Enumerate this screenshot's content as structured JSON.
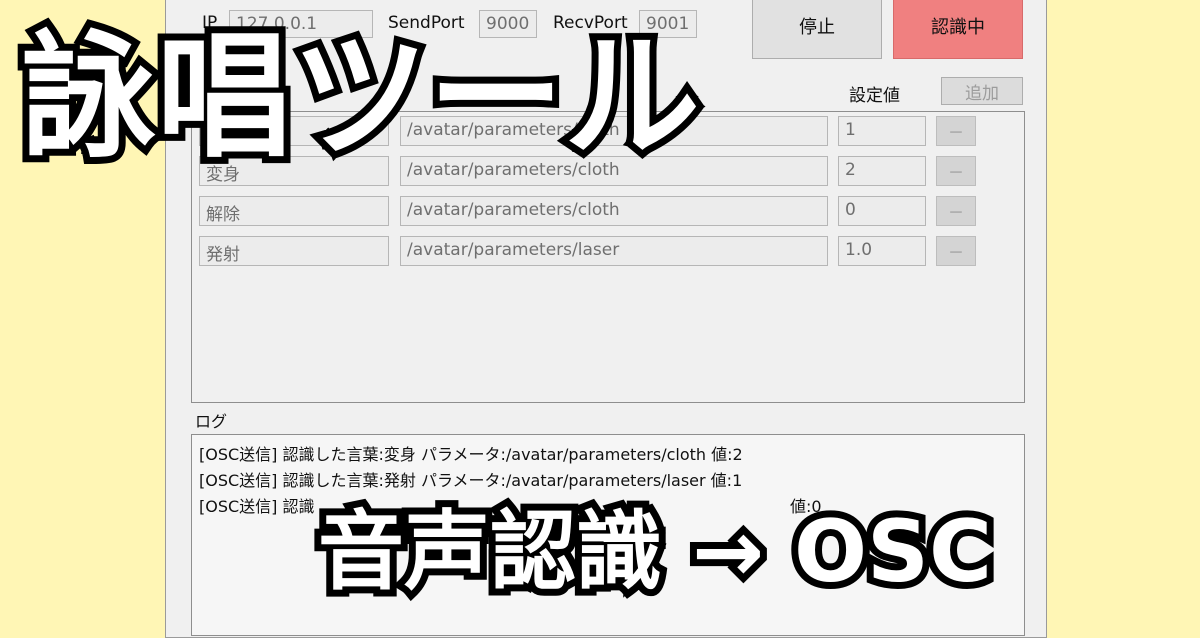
{
  "connection": {
    "ip_label": "IP",
    "ip_value": "127.0.0.1",
    "send_port_label": "SendPort",
    "send_port_value": "9000",
    "recv_port_label": "RecvPort",
    "recv_port_value": "9001"
  },
  "controls": {
    "stop_label": "停止",
    "recognizing_label": "認識中"
  },
  "mapping": {
    "value_header": "設定値",
    "add_label": "追加",
    "remove_label": "－",
    "rows": [
      {
        "word": "",
        "address": "/avatar/parameters/cloth",
        "value": "1"
      },
      {
        "word": "変身",
        "address": "/avatar/parameters/cloth",
        "value": "2"
      },
      {
        "word": "解除",
        "address": "/avatar/parameters/cloth",
        "value": "0"
      },
      {
        "word": "発射",
        "address": "/avatar/parameters/laser",
        "value": "1.0"
      }
    ]
  },
  "log": {
    "label": "ログ",
    "lines": [
      "[OSC送信] 認識した言葉:変身  パラメータ:/avatar/parameters/cloth  値:2",
      "[OSC送信] 認識した言葉:発射  パラメータ:/avatar/parameters/laser  値:1",
      "[OSC送信] 認識",
      "値:0"
    ]
  },
  "overlay": {
    "title": "詠唱ツール",
    "subtitle": "音声認識 → OSC"
  },
  "colors": {
    "background": "#fff6b5",
    "recognizing_button": "#f08080"
  }
}
